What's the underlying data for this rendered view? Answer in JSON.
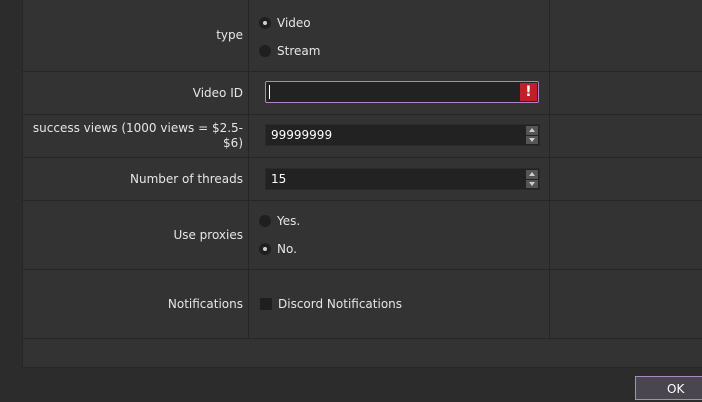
{
  "form": {
    "type": {
      "label": "type",
      "options": [
        {
          "label": "Video",
          "checked": true
        },
        {
          "label": "Stream",
          "checked": false
        }
      ]
    },
    "video_id": {
      "label": "Video ID",
      "value": "",
      "error_icon": "!"
    },
    "success_views": {
      "label_line1": "success views (1000 views = $2.5-",
      "label_line2": "$6)",
      "value": "99999999"
    },
    "threads": {
      "label": "Number of threads",
      "value": "15"
    },
    "proxies": {
      "label": "Use proxies",
      "options": [
        {
          "label": "Yes.",
          "checked": false
        },
        {
          "label": "No.",
          "checked": true
        }
      ]
    },
    "notifications": {
      "label": "Notifications",
      "checkbox_label": "Discord Notifications",
      "checked": false
    }
  },
  "footer": {
    "ok_label": "OK"
  },
  "colors": {
    "background": "#2c2c2c",
    "error": "#c0202a",
    "focus_border": "#b085c8"
  }
}
